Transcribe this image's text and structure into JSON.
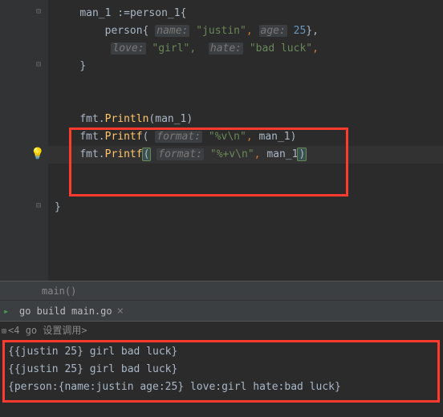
{
  "code": {
    "line1": {
      "var": "man_1",
      "op": ":=",
      "type": "person_1",
      "brace": "{"
    },
    "line2": {
      "type": "person",
      "brace_open": "{ ",
      "name_hint": "name:",
      "name_val": "\"justin\"",
      "age_hint": "age:",
      "age_val": "25",
      "close": "},"
    },
    "line3": {
      "love_hint": "love:",
      "love_val": "\"girl\",",
      "hate_hint": "hate:",
      "hate_val": "\"bad luck\""
    },
    "line4": {
      "brace": "}"
    },
    "line6": {
      "pkg": "fmt",
      "dot": ".",
      "fn": "Println",
      "open": "(",
      "arg": "man_1",
      "close": ")"
    },
    "line7": {
      "pkg": "fmt",
      "dot": ".",
      "fn": "Printf",
      "open": "( ",
      "hint": "format:",
      "str": "\"%v\\n\"",
      "comma": ", ",
      "arg": "man_1",
      "close": ")"
    },
    "line8": {
      "pkg": "fmt",
      "dot": ".",
      "fn": "Printf",
      "open": "(",
      "hint": "format:",
      "str": "\"%+v\\n\"",
      "comma": ", ",
      "arg": "man_1",
      "close": ")"
    },
    "line9": {
      "brace": "}"
    }
  },
  "breadcrumb": "main()",
  "tab": {
    "label": "go build main.go",
    "close": "×"
  },
  "console_header": "<4 go 设置调用>",
  "output": {
    "l1": "{{justin 25} girl bad luck}",
    "l2": "{{justin 25} girl bad luck}",
    "l3": "{person:{name:justin age:25} love:girl hate:bad luck}"
  }
}
